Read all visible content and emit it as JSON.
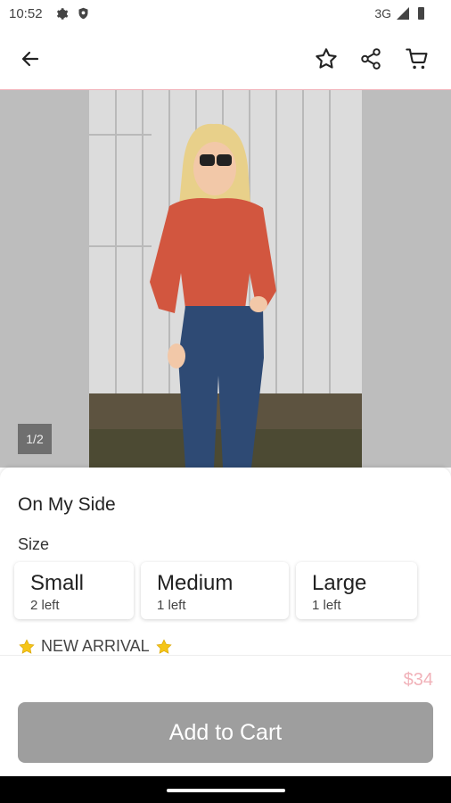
{
  "status_bar": {
    "time": "10:52",
    "network": "3G"
  },
  "product": {
    "title": "On My Side",
    "image_counter": "1/2",
    "badge": "NEW ARRIVAL"
  },
  "sizes": {
    "label": "Size",
    "options": [
      {
        "name": "Small",
        "stock": "2 left"
      },
      {
        "name": "Medium",
        "stock": "1 left"
      },
      {
        "name": "Large",
        "stock": "1 left"
      }
    ]
  },
  "checkout": {
    "price": "$34",
    "button_label": "Add to Cart"
  },
  "colors": {
    "accent_pink": "#f1b2b9",
    "button_gray": "#9e9e9e"
  },
  "icons": [
    "settings-icon",
    "shield-icon",
    "signal-icon",
    "battery-icon",
    "back-arrow-icon",
    "star-outline-icon",
    "share-icon",
    "cart-icon",
    "star-emoji-icon"
  ]
}
